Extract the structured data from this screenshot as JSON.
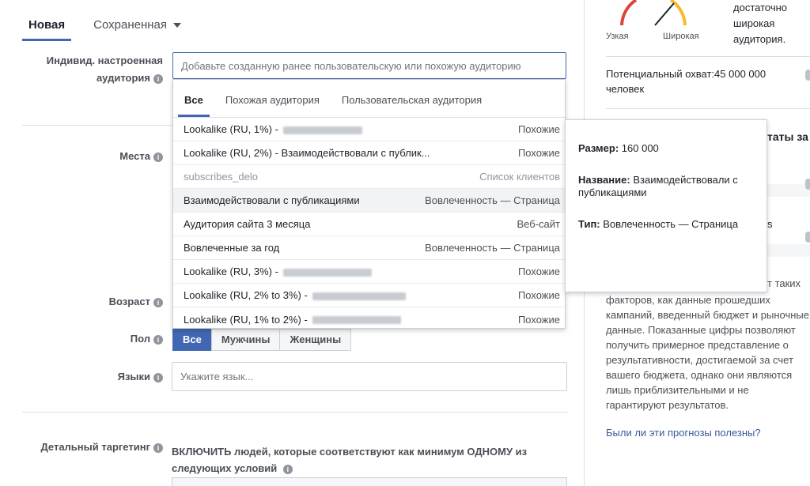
{
  "tabs": {
    "new": "Новая",
    "saved": "Сохраненная"
  },
  "labels": {
    "custom_audience_line1": "Индивид. настроенная",
    "custom_audience_line2": "аудитория",
    "places": "Места",
    "age": "Возраст",
    "gender": "Пол",
    "languages": "Языки",
    "detailed_targeting": "Детальный таргетинг"
  },
  "audience_input": {
    "placeholder": "Добавьте созданную ранее пользовательскую или похожую аудиторию"
  },
  "dropdown": {
    "tabs": [
      "Все",
      "Похожая аудитория",
      "Пользовательская аудитория"
    ],
    "rows": [
      {
        "name": "Lookalike (RU, 1%) -",
        "type": "Похожие"
      },
      {
        "name": "Lookalike (RU, 2%) - Взаимодействовали с публик...",
        "type": "Похожие"
      },
      {
        "name": "subscribes_delo",
        "type": "Список клиентов"
      },
      {
        "name": "Взаимодействовали с публикациями",
        "type": "Вовлеченность — Страница"
      },
      {
        "name": "Аудитория сайта 3 месяца",
        "type": "Веб-сайт"
      },
      {
        "name": "Вовлеченные за год",
        "type": "Вовлеченность — Страница"
      },
      {
        "name": "Lookalike (RU, 3%) -",
        "type": "Похожие"
      },
      {
        "name": "Lookalike (RU, 2% to 3%) -",
        "type": "Похожие"
      },
      {
        "name": "Lookalike (RU, 1% to 2%) -",
        "type": "Похожие"
      }
    ]
  },
  "tooltip": {
    "size_label": "Размер:",
    "size_value": "160 000",
    "name_label": "Название:",
    "name_value": "Взаимодействовали с публикациями",
    "type_label": "Тип:",
    "type_value": "Вовлеченность — Страница"
  },
  "gender_buttons": [
    "Все",
    "Мужчины",
    "Женщины"
  ],
  "languages_input": {
    "placeholder": "Укажите язык..."
  },
  "detailed_targeting_text": "ВКЛЮЧИТЬ людей, которые соответствуют как минимум ОДНОМУ из следующих условий",
  "right_panel": {
    "gauge_narrow": "Узкая",
    "gauge_wide": "Широкая",
    "audience_desc": "достаточно широкая аудитория.",
    "reach": "Потенциальный охват:45 000 000 человек",
    "partial_heading": "таты за",
    "partial_s": "s",
    "partial_taких": "т таких",
    "disclaimer": "факторов, как данные прошедших кампаний, введенный бюджет и рыночные данные. Показанные цифры позволяют получить примерное представление о результативности, достигаемой за счет вашего бюджета, однако они являются лишь приблизительными и не гарантируют результатов.",
    "feedback_link": "Были ли эти прогнозы полезны?"
  },
  "colors": {
    "accent": "#4267b2",
    "link": "#385898",
    "gauge_red": "#d9473b",
    "gauge_green": "#42b72a",
    "gauge_orange": "#f7b928"
  }
}
